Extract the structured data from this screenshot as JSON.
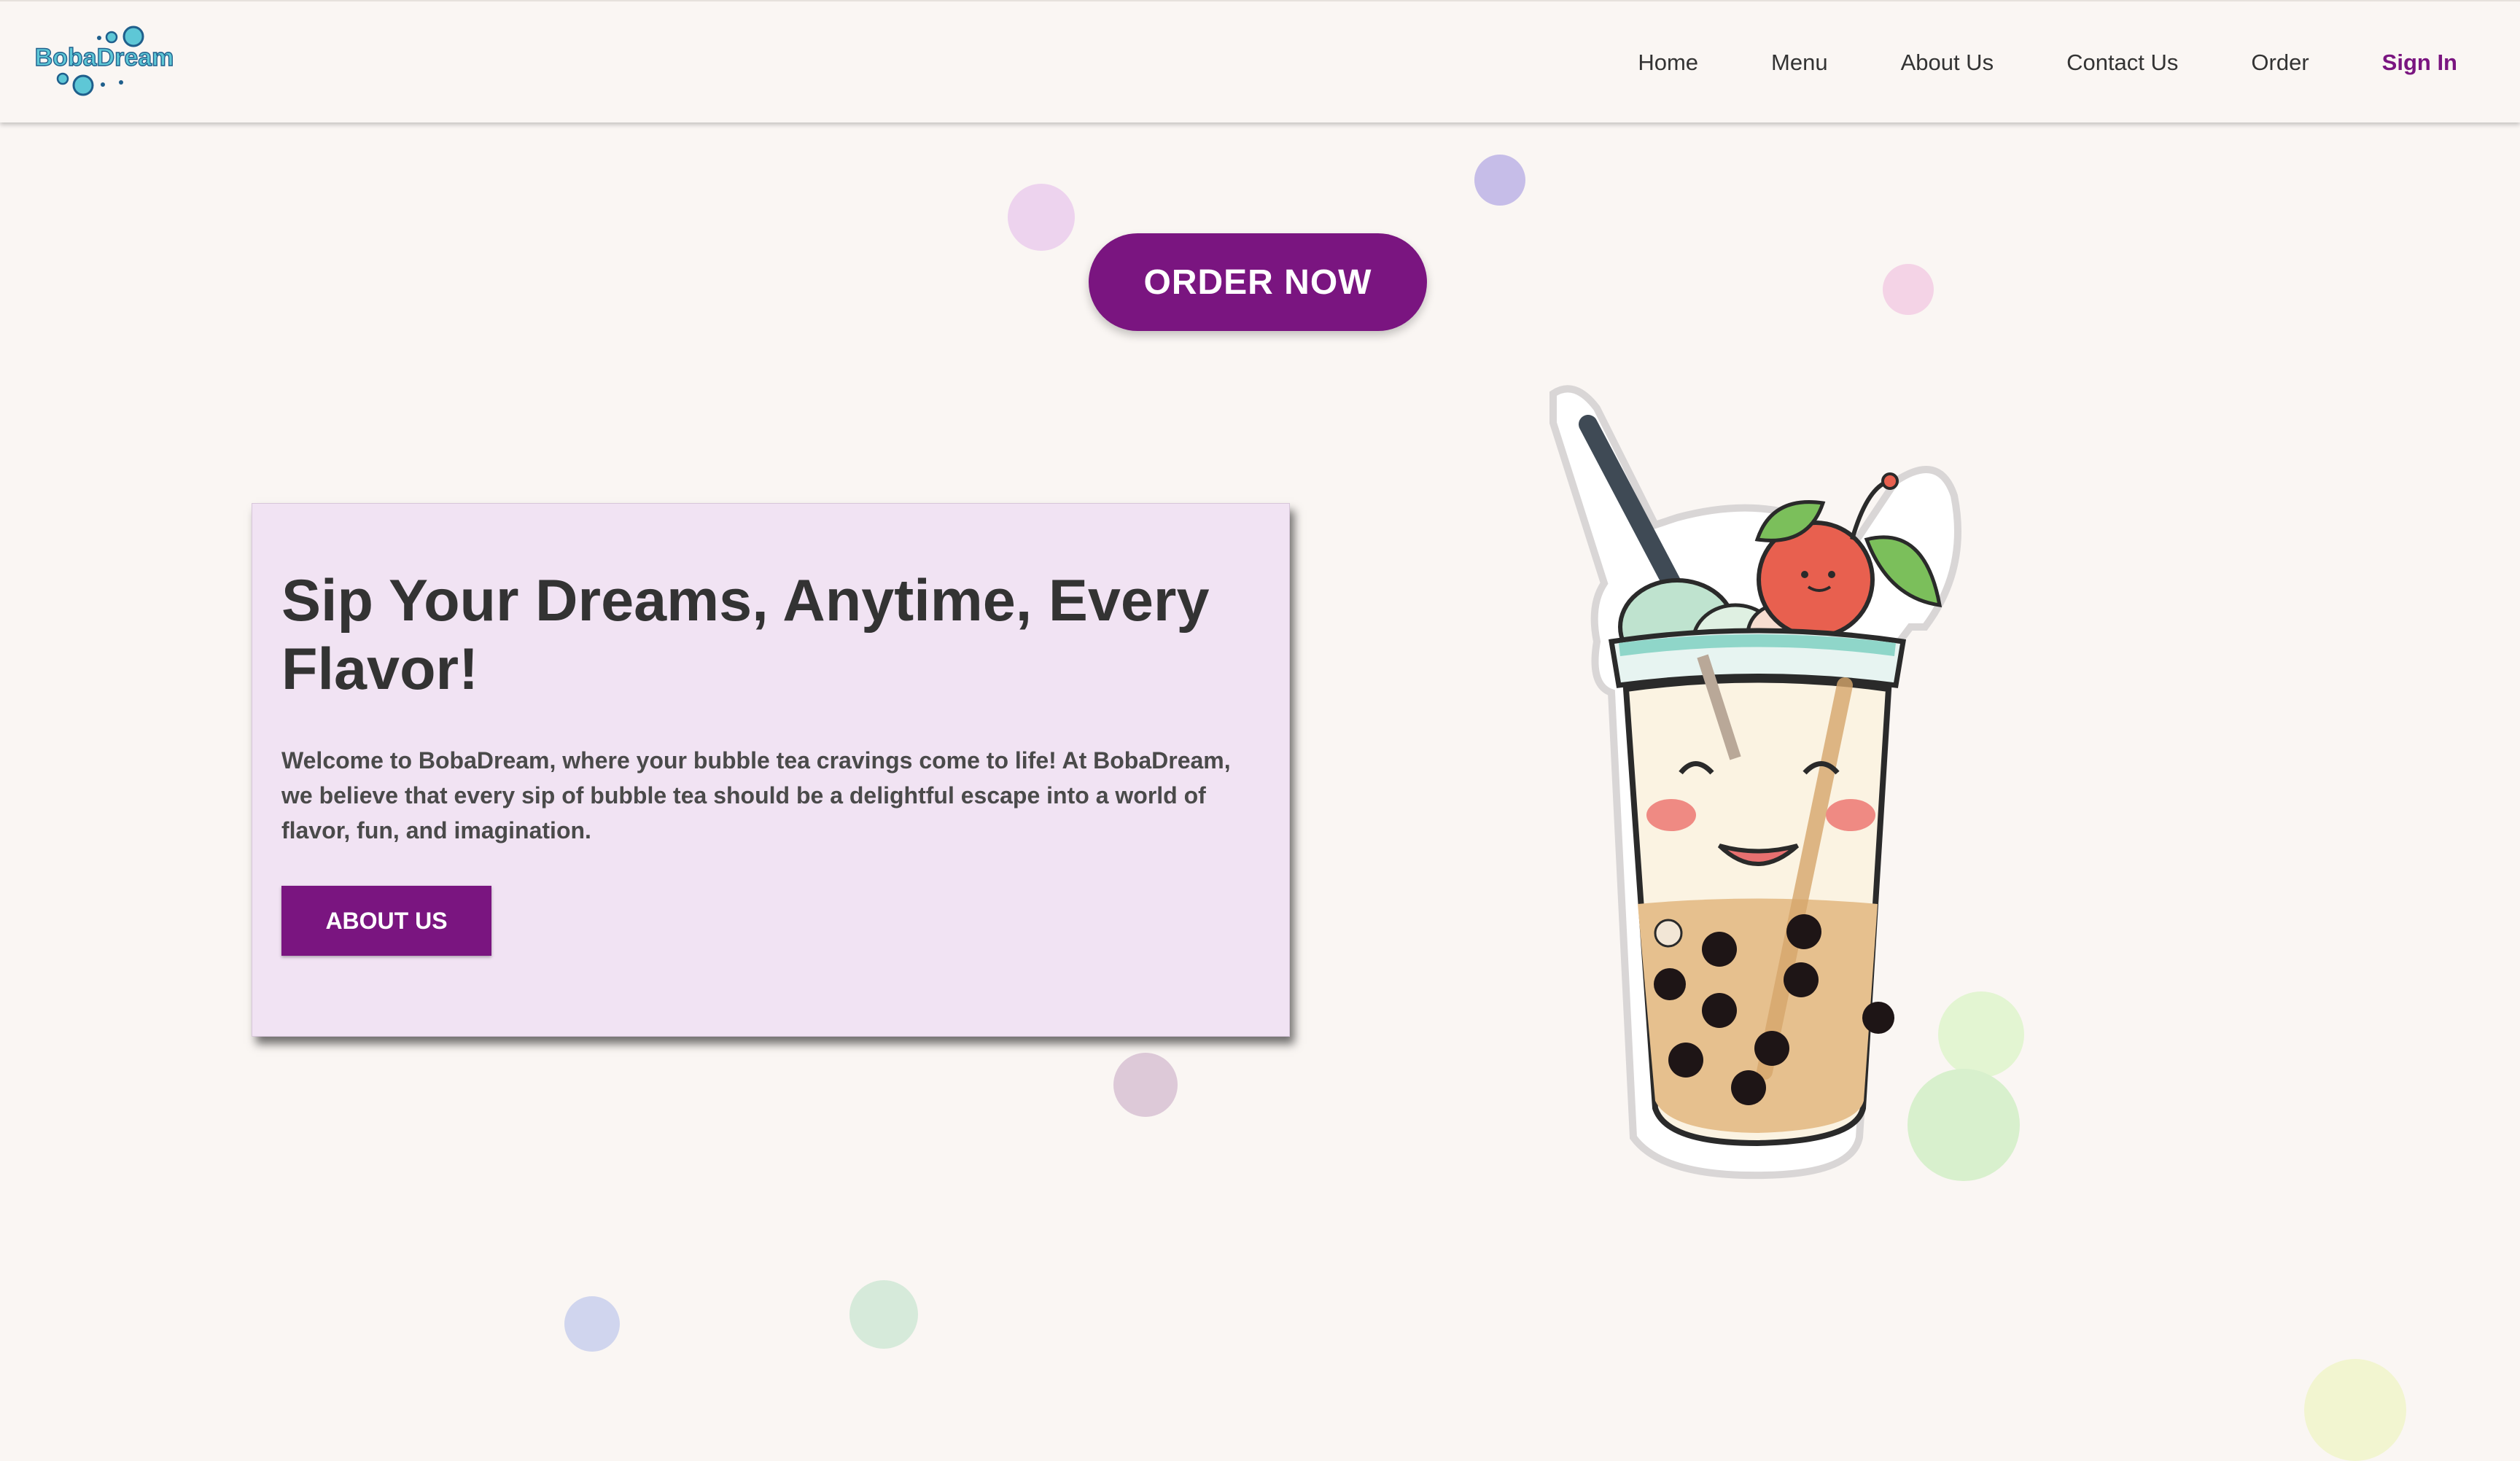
{
  "header": {
    "logo_text": "BobaDream",
    "nav": [
      {
        "label": "Home"
      },
      {
        "label": "Menu"
      },
      {
        "label": "About Us"
      },
      {
        "label": "Contact Us"
      },
      {
        "label": "Order"
      },
      {
        "label": "Sign In"
      }
    ]
  },
  "cta": {
    "order_now": "ORDER NOW"
  },
  "hero": {
    "title": "Sip Your Dreams, Anytime, Every Flavor!",
    "description": "Welcome to BobaDream, where your bubble tea cravings come to life! At BobaDream, we believe that every sip of bubble tea should be a delightful escape into a world of flavor, fun, and imagination.",
    "about_button": "ABOUT US"
  },
  "colors": {
    "brand_purple": "#7a1580",
    "page_background": "#faf6f3",
    "card_background": "#f1e3f3",
    "logo_text": "#1f5f8c",
    "logo_bubbles": "#5ec7d6"
  },
  "illustration": {
    "name": "smiling bubble tea cup with cherry",
    "icon": "boba-cup-icon"
  }
}
